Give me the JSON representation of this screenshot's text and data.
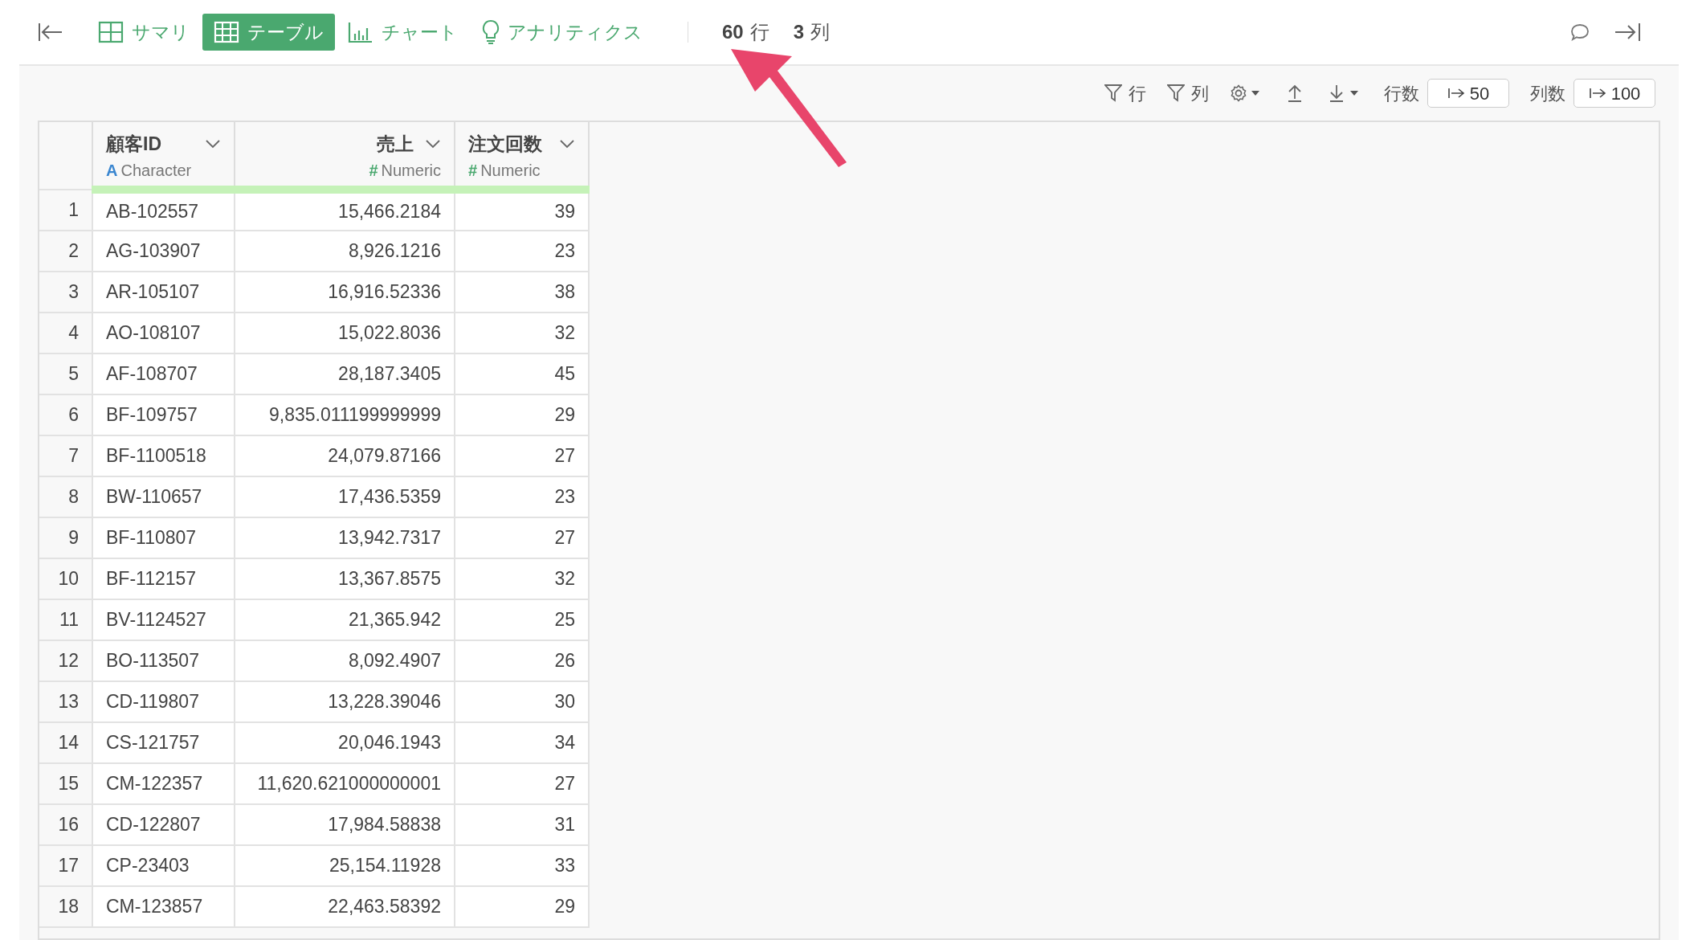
{
  "tabs": [
    {
      "label": "サマリ",
      "kind": "summary",
      "selected": false
    },
    {
      "label": "テーブル",
      "kind": "table",
      "selected": true
    },
    {
      "label": "チャート",
      "kind": "chart",
      "selected": false
    },
    {
      "label": "アナリティクス",
      "kind": "analytics",
      "selected": false
    }
  ],
  "counts": [
    {
      "number": "60",
      "unit": "行"
    },
    {
      "number": "3",
      "unit": "列"
    }
  ],
  "toolbar": {
    "row_filter": "行",
    "column_filter": "列",
    "row_limit_label": "行数",
    "row_limit": "50",
    "column_limit_label": "列数",
    "column_limit": "100"
  },
  "table": {
    "columns": [
      {
        "kind": "index"
      },
      {
        "name": "顧客ID",
        "type_mark": "A",
        "type": "Character",
        "kind": "character"
      },
      {
        "name": "売上",
        "type_mark": "#",
        "type": "Numeric",
        "kind": "numeric"
      },
      {
        "name": "注文回数",
        "type_mark": "#",
        "type": "Numeric",
        "kind": "numeric"
      }
    ],
    "rows": [
      [
        "1",
        "AB-102557",
        "15,466.2184",
        "39"
      ],
      [
        "2",
        "AG-103907",
        "8,926.1216",
        "23"
      ],
      [
        "3",
        "AR-105107",
        "16,916.52336",
        "38"
      ],
      [
        "4",
        "AO-108107",
        "15,022.8036",
        "32"
      ],
      [
        "5",
        "AF-108707",
        "28,187.3405",
        "45"
      ],
      [
        "6",
        "BF-109757",
        "9,835.011199999999",
        "29"
      ],
      [
        "7",
        "BF-1100518",
        "24,079.87166",
        "27"
      ],
      [
        "8",
        "BW-110657",
        "17,436.5359",
        "23"
      ],
      [
        "9",
        "BF-110807",
        "13,942.7317",
        "27"
      ],
      [
        "10",
        "BF-112157",
        "13,367.8575",
        "32"
      ],
      [
        "11",
        "BV-1124527",
        "21,365.942",
        "25"
      ],
      [
        "12",
        "BO-113507",
        "8,092.4907",
        "26"
      ],
      [
        "13",
        "CD-119807",
        "13,228.39046",
        "30"
      ],
      [
        "14",
        "CS-121757",
        "20,046.1943",
        "34"
      ],
      [
        "15",
        "CM-122357",
        "11,620.621000000001",
        "27"
      ],
      [
        "16",
        "CD-122807",
        "17,984.58838",
        "31"
      ],
      [
        "17",
        "CP-23403",
        "25,154.11928",
        "33"
      ],
      [
        "18",
        "CM-123857",
        "22,463.58392",
        "29"
      ]
    ]
  }
}
